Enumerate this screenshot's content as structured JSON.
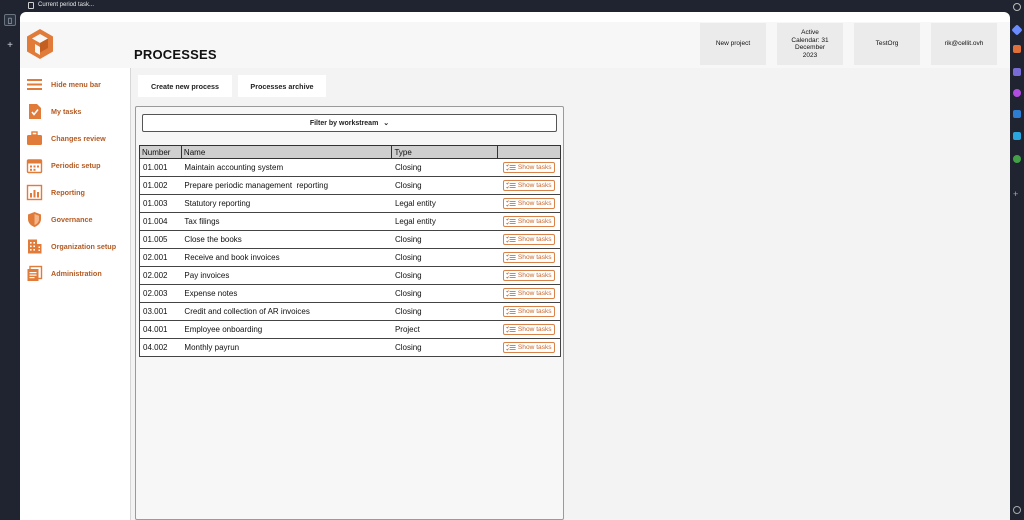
{
  "browser": {
    "tab_title": "Current period task..."
  },
  "header": {
    "title": "PROCESSES",
    "buttons": {
      "new_project": "New project",
      "active_calendar": "Active Calendar: 31 December 2023",
      "org": "TestOrg",
      "user": "rik@cellit.ovh"
    }
  },
  "sidebar": {
    "items": [
      {
        "label": "Hide menu bar",
        "icon": "hamburger-icon"
      },
      {
        "label": "My tasks",
        "icon": "task-check-icon"
      },
      {
        "label": "Changes review",
        "icon": "briefcase-icon"
      },
      {
        "label": "Periodic setup",
        "icon": "calendar-icon"
      },
      {
        "label": "Reporting",
        "icon": "bar-chart-icon"
      },
      {
        "label": "Governance",
        "icon": "shield-icon"
      },
      {
        "label": "Organization setup",
        "icon": "building-icon"
      },
      {
        "label": "Administration",
        "icon": "documents-icon"
      }
    ]
  },
  "toolbar": {
    "create_label": "Create new process",
    "archive_label": "Processes archive"
  },
  "filter": {
    "label": "Filter by workstream"
  },
  "table": {
    "headers": [
      "Number",
      "Name",
      "Type",
      ""
    ],
    "action_label": "Show tasks",
    "rows": [
      {
        "number": "01.001",
        "name": "Maintain accounting system",
        "type": "Closing"
      },
      {
        "number": "01.002",
        "name": "Prepare periodic management  reporting",
        "type": "Closing"
      },
      {
        "number": "01.003",
        "name": "Statutory reporting",
        "type": "Legal entity"
      },
      {
        "number": "01.004",
        "name": "Tax filings",
        "type": "Legal entity"
      },
      {
        "number": "01.005",
        "name": "Close the books",
        "type": "Closing"
      },
      {
        "number": "02.001",
        "name": "Receive and book invoices",
        "type": "Closing"
      },
      {
        "number": "02.002",
        "name": "Pay invoices",
        "type": "Closing"
      },
      {
        "number": "02.003",
        "name": "Expense notes",
        "type": "Closing"
      },
      {
        "number": "03.001",
        "name": "Credit and collection of AR invoices",
        "type": "Closing"
      },
      {
        "number": "04.001",
        "name": "Employee onboarding",
        "type": "Project"
      },
      {
        "number": "04.002",
        "name": "Monthly payrun",
        "type": "Closing"
      }
    ]
  },
  "colors": {
    "accent": "#e07b39",
    "label": "#b35a22"
  }
}
